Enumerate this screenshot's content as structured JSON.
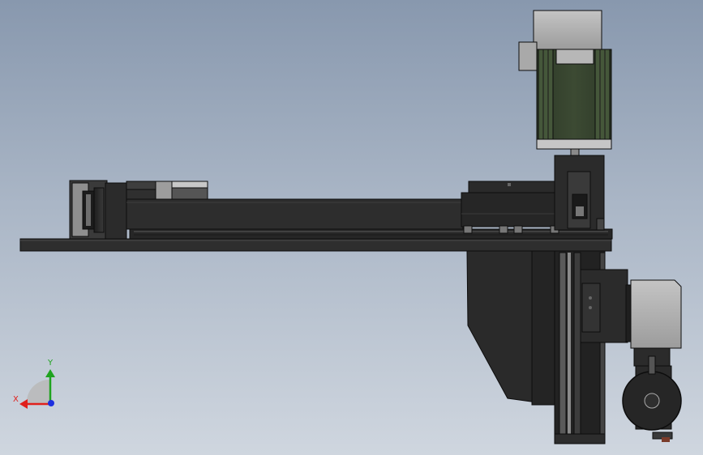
{
  "view": {
    "type": "cad-side-view",
    "background_top": "#8898ae",
    "background_bottom": "#cfd6df"
  },
  "triad": {
    "x_label": "X",
    "y_label": "Y",
    "x_color": "#e0201c",
    "y_color": "#1fa31f",
    "z_color": "#1c2fe0"
  },
  "colors": {
    "body_dark": "#2b2b2b",
    "body_mid": "#3a3a3a",
    "edge": "#0d0d0d",
    "motor_green": "#37452f",
    "motor_grey": "#b4b4b4",
    "bracket_grey": "#4a4a4a"
  }
}
